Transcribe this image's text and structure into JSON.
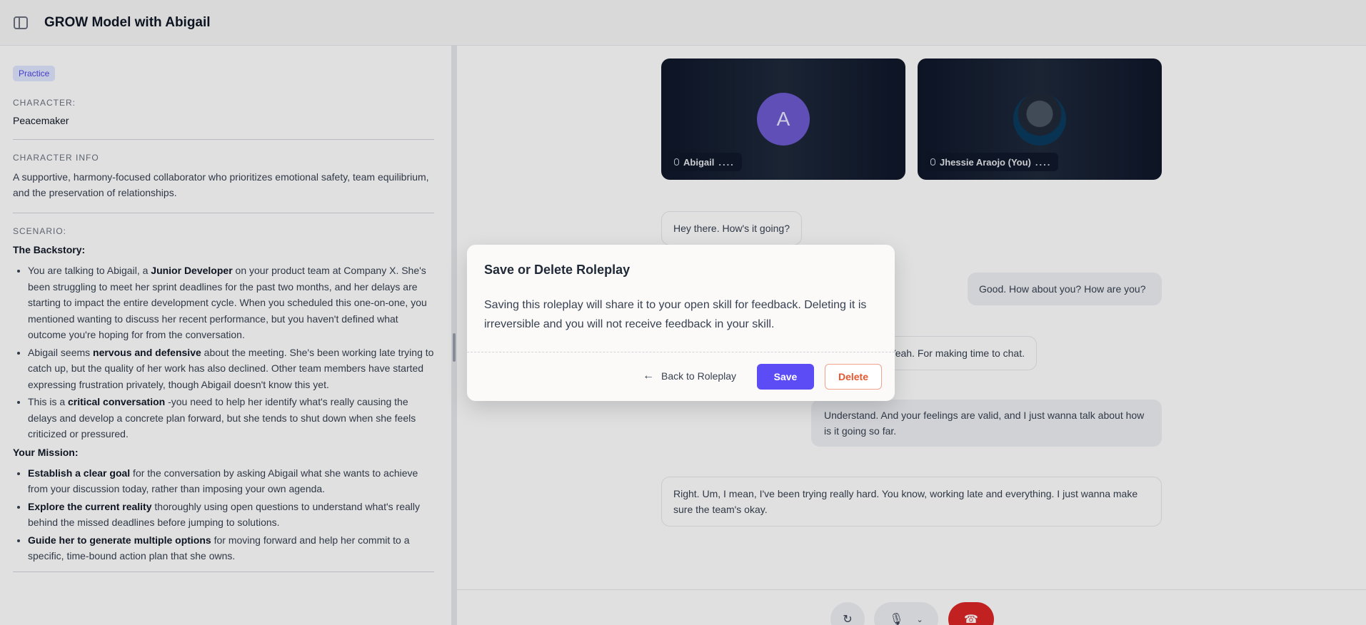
{
  "header": {
    "title": "GROW Model with Abigail"
  },
  "sidebar": {
    "tag": "Practice",
    "character_label": "CHARACTER:",
    "character_value": "Peacemaker",
    "info_label": "CHARACTER INFO",
    "info_text": "A supportive, harmony-focused collaborator who prioritizes emotional safety, team equilibrium, and the preservation of relationships.",
    "scenario_label": "SCENARIO:",
    "backstory_heading": "The Backstory:",
    "backstory": [
      {
        "pre": "You are talking to Abigail, a ",
        "bold": "Junior Developer",
        "post": " on your product team at Company X. She's been struggling to meet her sprint deadlines for the past two months, and her delays are starting to impact the entire development cycle. When you scheduled this one-on-one, you mentioned wanting to discuss her recent performance, but you haven't defined what outcome you're hoping for from the conversation."
      },
      {
        "pre": "Abigail seems ",
        "bold": "nervous and defensive",
        "post": " about the meeting. She's been working late trying to catch up, but the quality of her work has also declined. Other team members have started expressing frustration privately, though Abigail doesn't know this yet."
      },
      {
        "pre": "This is a ",
        "bold": "critical conversation",
        "post": " -you need to help her identify what's really causing the delays and develop a concrete plan forward, but she tends to shut down when she feels criticized or pressured."
      }
    ],
    "mission_heading": "Your Mission:",
    "mission": [
      {
        "pre": "",
        "bold": "Establish a clear goal",
        "post": " for the conversation by asking Abigail what she wants to achieve from your discussion today, rather than imposing your own agenda."
      },
      {
        "pre": "",
        "bold": "Explore the current reality",
        "post": " thoroughly using open questions to understand what's really behind the missed deadlines before jumping to solutions."
      },
      {
        "pre": "",
        "bold": "Guide her to generate multiple options",
        "post": " for moving forward and help her commit to a specific, time-bound action plan that she owns."
      }
    ]
  },
  "video": {
    "ai_initial": "A",
    "ai_name": "Abigail",
    "user_name": "Jhessie Araojo (You)",
    "dots": "...."
  },
  "chat": {
    "m1": "Hey there. How's it going?",
    "m2": "Good. How about you? How are you?",
    "m3": "Yeah. For making time to chat.",
    "m4": "Understand. And your feelings are valid, and I just wanna talk about how is it going so far.",
    "m5": "Right. Um, I mean, I've been trying really hard. You know, working late and everything. I just wanna make sure the team's okay."
  },
  "modal": {
    "title": "Save or Delete Roleplay",
    "body": "Saving this roleplay will share it to your open skill for feedback. Deleting it is irreversible and you will not receive feedback in your skill.",
    "back_label": "Back to Roleplay",
    "save_label": "Save",
    "delete_label": "Delete"
  }
}
